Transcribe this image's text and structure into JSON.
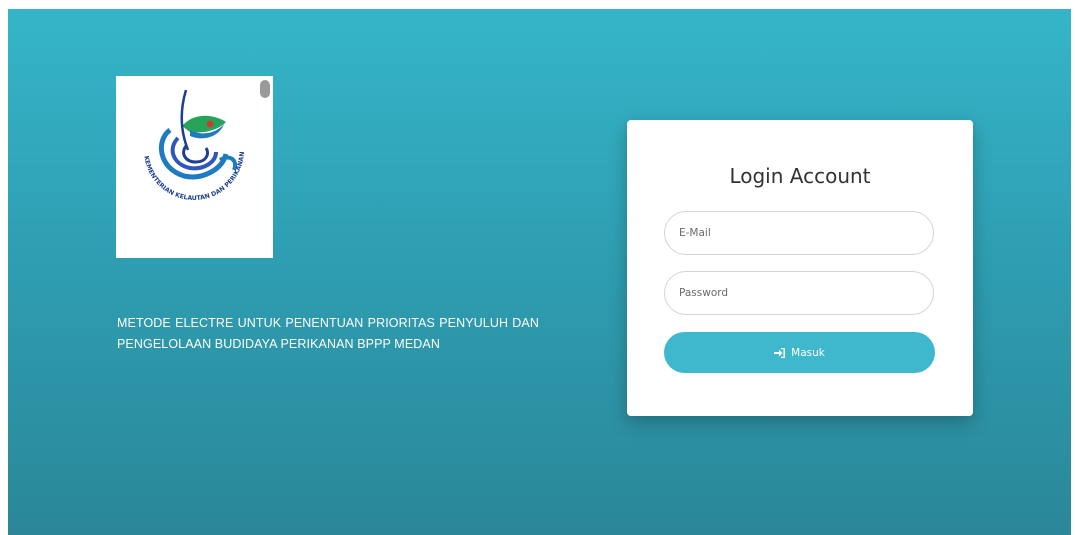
{
  "logo": {
    "alt": "Kementerian Kelautan dan Perikanan logo",
    "text": "KEMENTERIAN KELAUTAN DAN PERIKANAN"
  },
  "tagline": "METODE ELECTRE UNTUK PENENTUAN PRIORITAS PENYULUH DAN PENGELOLAAN BUDIDAYA PERIKANAN BPPP MEDAN",
  "login": {
    "title": "Login Account",
    "email_placeholder": "E-Mail",
    "password_placeholder": "Password",
    "submit_label": "Masuk",
    "submit_icon": "sign-in-icon"
  },
  "colors": {
    "background_top": "#35b5c9",
    "background_bottom": "#2a8799",
    "button": "#3fb7cc",
    "card": "#ffffff"
  }
}
